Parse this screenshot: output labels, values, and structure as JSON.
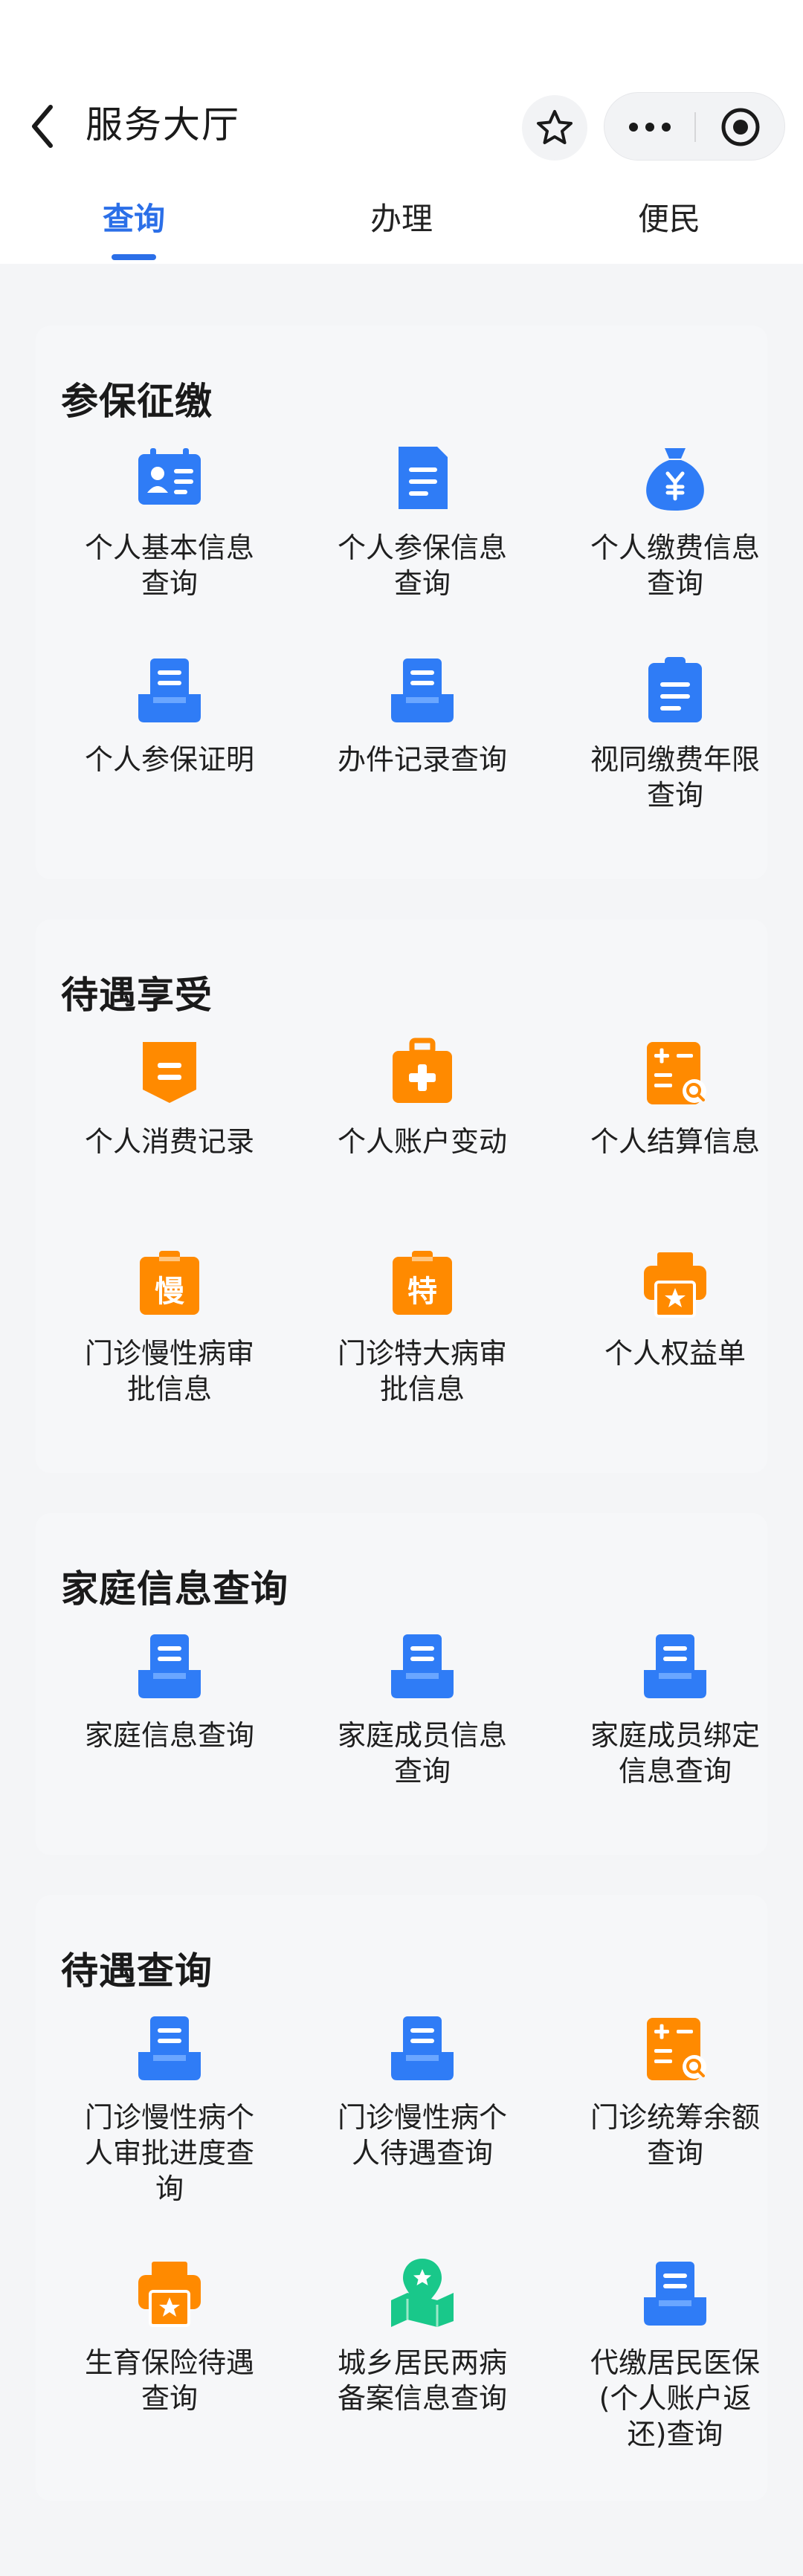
{
  "header": {
    "title": "服务大厅",
    "tabs": [
      {
        "label": "查询",
        "active": true
      },
      {
        "label": "办理",
        "active": false
      },
      {
        "label": "便民",
        "active": false
      }
    ]
  },
  "colors": {
    "accent": "#2b6fe8",
    "blue_icon": "#2f7cf6",
    "orange_icon": "#ff8a00",
    "green_icon": "#19c88a"
  },
  "sections": [
    {
      "title": "参保征缴",
      "items": [
        {
          "label": "个人基本信息查询",
          "icon": "id-card-icon"
        },
        {
          "label": "个人参保信息查询",
          "icon": "document-icon"
        },
        {
          "label": "个人缴费信息查询",
          "icon": "money-bag-icon"
        },
        {
          "label": "个人参保证明",
          "icon": "tray-document-icon"
        },
        {
          "label": "办件记录查询",
          "icon": "tray-document-icon"
        },
        {
          "label": "视同缴费年限查询",
          "icon": "clipboard-icon"
        }
      ]
    },
    {
      "title": "待遇享受",
      "items": [
        {
          "label": "个人消费记录",
          "icon": "receipt-icon"
        },
        {
          "label": "个人账户变动",
          "icon": "medical-kit-icon"
        },
        {
          "label": "个人结算信息",
          "icon": "calculator-search-icon"
        },
        {
          "label": "门诊慢性病审批信息",
          "icon": "chronic-badge-icon",
          "glyph": "慢"
        },
        {
          "label": "门诊特大病审批信息",
          "icon": "serious-badge-icon",
          "glyph": "特"
        },
        {
          "label": "个人权益单",
          "icon": "printer-icon"
        }
      ]
    },
    {
      "title": "家庭信息查询",
      "items": [
        {
          "label": "家庭信息查询",
          "icon": "tray-document-icon"
        },
        {
          "label": "家庭成员信息查询",
          "icon": "tray-document-icon"
        },
        {
          "label": "家庭成员绑定信息查询",
          "icon": "tray-document-icon"
        }
      ]
    },
    {
      "title": "待遇查询",
      "items": [
        {
          "label": "门诊慢性病个人审批进度查询",
          "icon": "tray-document-icon"
        },
        {
          "label": "门诊慢性病个人待遇查询",
          "icon": "tray-document-icon"
        },
        {
          "label": "门诊统筹余额查询",
          "icon": "calculator-search-icon"
        },
        {
          "label": "生育保险待遇查询",
          "icon": "printer-icon"
        },
        {
          "label": "城乡居民两病备案信息查询",
          "icon": "map-pin-icon"
        },
        {
          "label": "代缴居民医保(个人账户返还)查询",
          "icon": "tray-document-icon"
        }
      ]
    }
  ]
}
